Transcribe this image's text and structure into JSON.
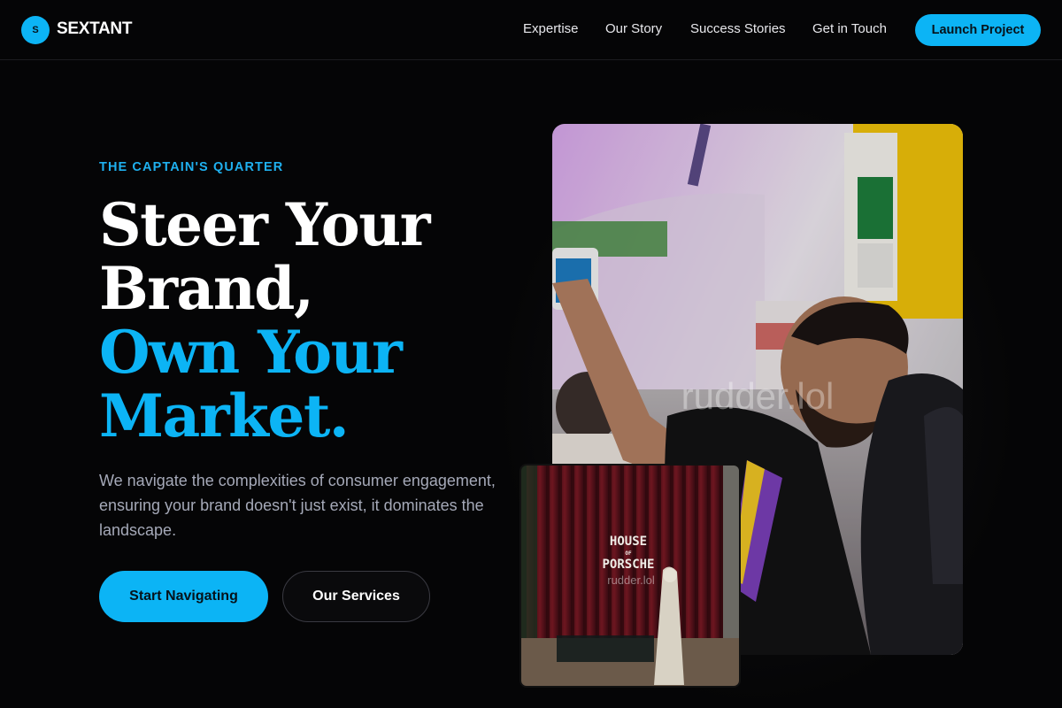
{
  "brand": {
    "logo_letter": "S",
    "name": "SEXTANT"
  },
  "nav": {
    "links": [
      "Expertise",
      "Our Story",
      "Success Stories",
      "Get in Touch"
    ],
    "cta": "Launch Project"
  },
  "hero": {
    "eyebrow": "THE CAPTAIN'S QUARTER",
    "headline": [
      "Steer Your",
      "Brand,",
      "Own Your",
      "Market."
    ],
    "lede": "We navigate the complexities of consumer engagement, ensuring your brand doesn't just exist, it dominates the landscape.",
    "primary_button": "Start Navigating",
    "secondary_button": "Our Services"
  },
  "images": {
    "main_watermark": "rudder.lol",
    "small_sign": [
      "HOUSE",
      "OF",
      "PORSCHE"
    ],
    "small_watermark": "rudder.lol"
  },
  "colors": {
    "accent": "#0cb4f5",
    "background": "#050506",
    "muted_text": "#a5a9b8"
  }
}
